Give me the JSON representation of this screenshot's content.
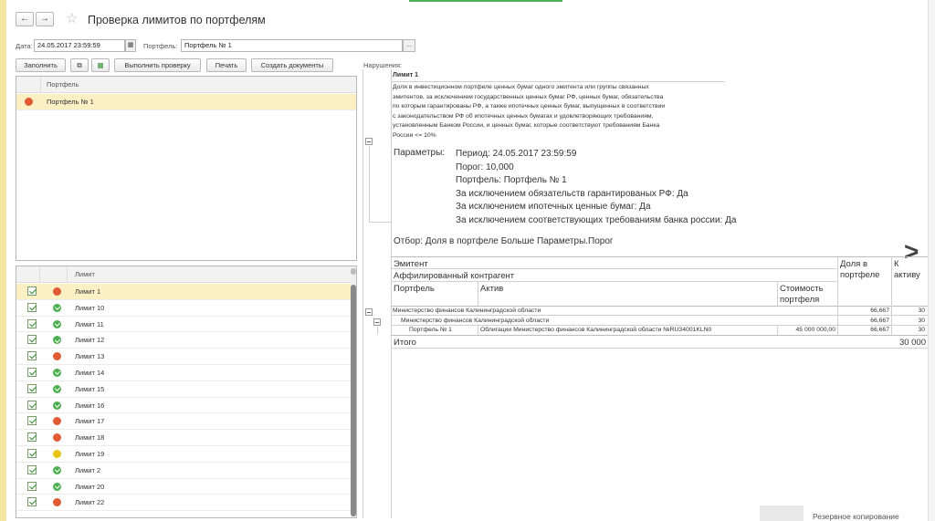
{
  "window": {
    "title": "Проверка лимитов по портфелям",
    "back_glyph": "←",
    "forward_glyph": "→",
    "star_glyph": "☆"
  },
  "filters": {
    "date_label": "Дата:",
    "date_value": "24.05.2017 23:59:59",
    "calendar_glyph": "▦",
    "portfolio_label": "Портфель:",
    "portfolio_value": "Портфель № 1",
    "select_glyph": "..."
  },
  "toolbar": {
    "fill_label": "Заполнить",
    "copy_glyph": "⧉",
    "excel_glyph": "▦",
    "run_check_label": "Выполнить проверку",
    "print_label": "Печать",
    "create_docs_label": "Создать документы"
  },
  "portfolio_table": {
    "header": "Портфель",
    "rows": [
      {
        "status": "red",
        "name": "Портфель № 1"
      }
    ]
  },
  "limits_table": {
    "header": "Лимит",
    "rows": [
      {
        "status": "red",
        "name": "Лимит 1"
      },
      {
        "status": "green",
        "name": "Лимит 10"
      },
      {
        "status": "green",
        "name": "Лимит 11"
      },
      {
        "status": "green",
        "name": "Лимит 12"
      },
      {
        "status": "red",
        "name": "Лимит 13"
      },
      {
        "status": "green",
        "name": "Лимит 14"
      },
      {
        "status": "green",
        "name": "Лимит 15"
      },
      {
        "status": "green",
        "name": "Лимит 16"
      },
      {
        "status": "red",
        "name": "Лимит 17"
      },
      {
        "status": "red",
        "name": "Лимит 18"
      },
      {
        "status": "yellow",
        "name": "Лимит 19"
      },
      {
        "status": "green",
        "name": "Лимит 2"
      },
      {
        "status": "green",
        "name": "Лимит 20"
      },
      {
        "status": "red",
        "name": "Лимит 22"
      }
    ]
  },
  "violations": {
    "label": "Нарушения:",
    "limit_title": "Лимит 1",
    "description_lines": [
      "Доля в инвестиционном портфеле ценных бумаг одного эмитента или группы связанных",
      "эмитентов, за исключением государственных ценных бумаг РФ, ценных бумаг, обязательства",
      "по которым гарантированы РФ, а также ипотечных ценных бумаг, выпущенных в соответствии",
      "с законодательством РФ об ипотечных ценных бумагах и удовлетворяющих требованиям,",
      "установленным Банком России, и ценных бумаг, которые соответствуют требованиям Банка",
      "России <= 10%"
    ],
    "params_label": "Параметры:",
    "params": [
      "Период: 24.05.2017 23:59:59",
      "Порог: 10,000",
      "Портфель: Портфель № 1",
      "За исключением обязательств гарантированых РФ: Да",
      "За исключением ипотечных ценные бумаг: Да",
      "За исключением соответствующих требованиям банка россии: Да"
    ],
    "filter_text": "Отбор: Доля в портфеле Больше Параметры.Порог",
    "table": {
      "h_issuer": "Эмитент",
      "h_affiliate": "Аффилированный контрагент",
      "h_portfolio": "Портфель",
      "h_asset": "Актив",
      "h_cost": "Стоимость портфеля",
      "h_share": "Доля в портфеле",
      "h_kasset": "К активу",
      "row1_name": "Министерство финансов Калининградской области",
      "row1_share": "66,667",
      "row1_k": "30",
      "row2_name": "Министерство финансов Калининградской области",
      "row2_share": "66,667",
      "row2_k": "30",
      "row3_portfolio": "Портфель № 1",
      "row3_asset": "Облигации Министерство финансов Калининградской области №RU34001KLN0",
      "row3_cost": "45 000 000,00",
      "row3_share": "66,667",
      "row3_k": "30",
      "total_label": "Итого",
      "total_k": "30 000"
    },
    "next_glyph": ">"
  },
  "footer": {
    "backup_text": "Резервное копирование"
  }
}
